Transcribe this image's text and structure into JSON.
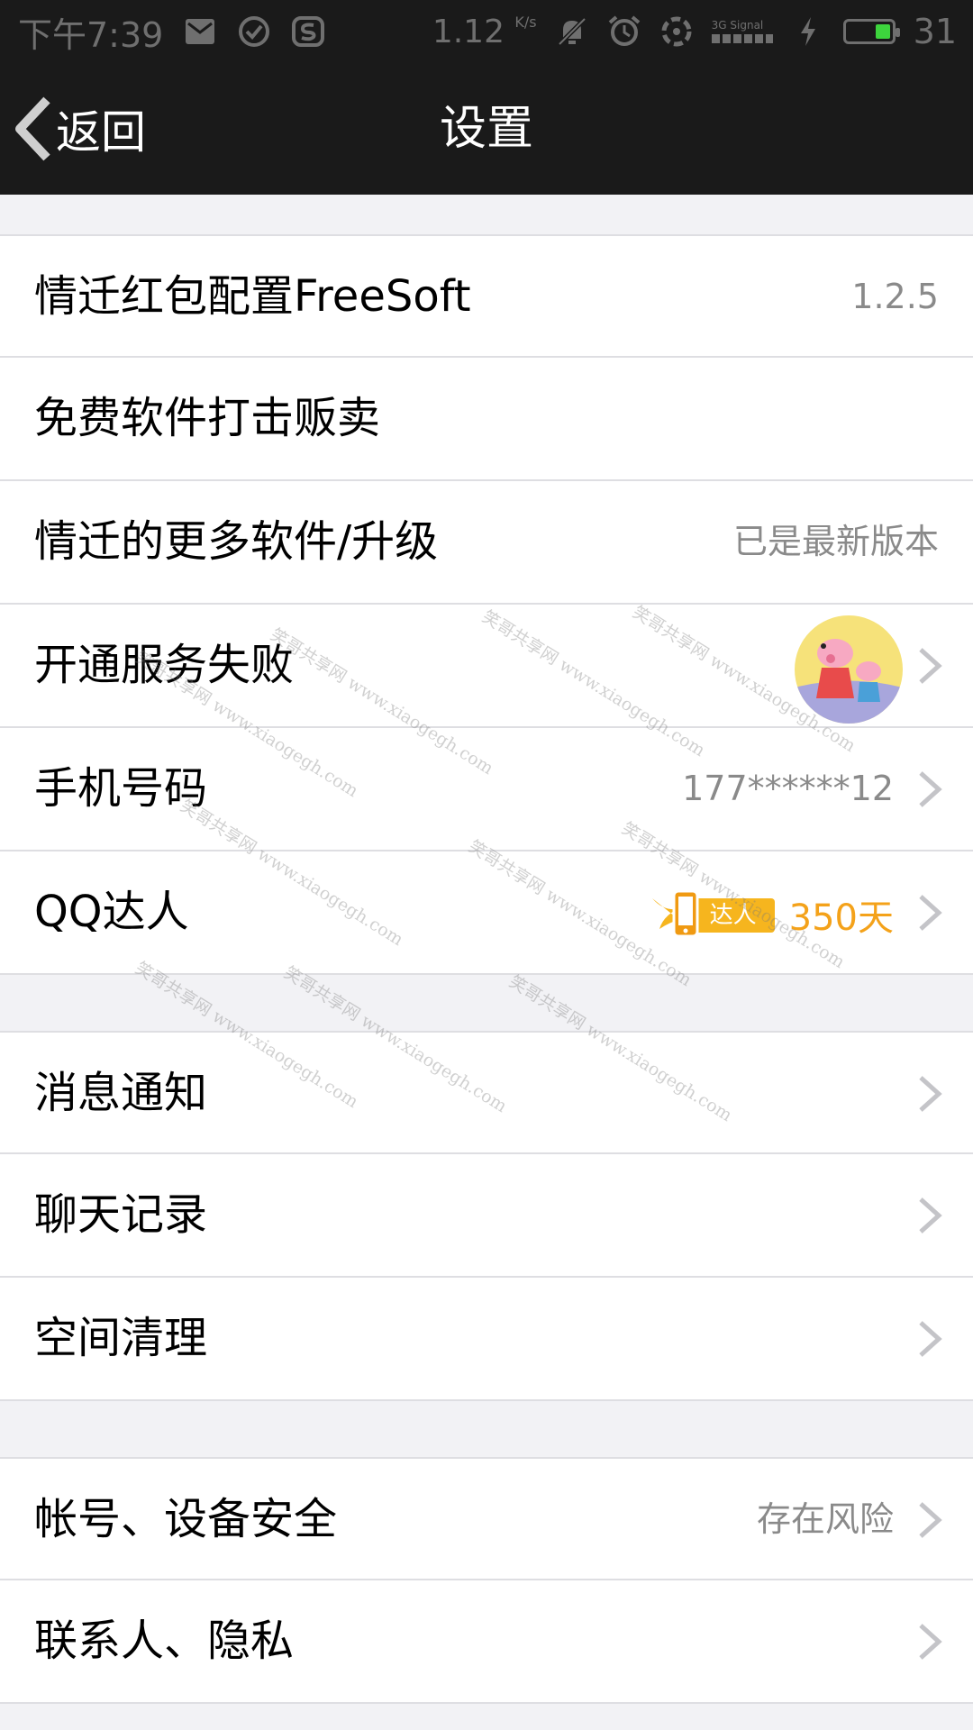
{
  "status_bar": {
    "time": "下午7:39",
    "net_speed": "1.12",
    "net_speed_unit": "K/s",
    "network_type": "3G",
    "signal_label": "Signal",
    "battery_level": "31",
    "icons": [
      "mail-icon",
      "check-circle-icon",
      "sogou-icon",
      "mute-icon",
      "alarm-icon",
      "vpn-icon",
      "signal-icon",
      "charging-icon",
      "battery-icon"
    ]
  },
  "header": {
    "back_label": "返回",
    "title": "设置"
  },
  "groups": [
    {
      "items": [
        {
          "label": "情迁红包配置FreeSoft",
          "value": "1.2.5",
          "chevron": false
        },
        {
          "label": "免费软件打击贩卖",
          "value": "",
          "chevron": false
        },
        {
          "label": "情迁的更多软件/升级",
          "value": "已是最新版本",
          "chevron": false
        },
        {
          "label": "开通服务失败",
          "value": "",
          "chevron": true,
          "accessory": "avatar"
        },
        {
          "label": "手机号码",
          "value": "177******12",
          "chevron": true
        },
        {
          "label": "QQ达人",
          "value": "",
          "chevron": true,
          "accessory": "qq-badge",
          "badge_text": "达人",
          "days": "350天"
        }
      ]
    },
    {
      "items": [
        {
          "label": "消息通知",
          "value": "",
          "chevron": true
        },
        {
          "label": "聊天记录",
          "value": "",
          "chevron": true
        },
        {
          "label": "空间清理",
          "value": "",
          "chevron": true
        }
      ]
    },
    {
      "items": [
        {
          "label": "帐号、设备安全",
          "value": "存在风险",
          "chevron": true
        },
        {
          "label": "联系人、隐私",
          "value": "",
          "chevron": true
        }
      ]
    }
  ],
  "watermark_text": "笑哥共享网 www.xiaogegh.com",
  "colors": {
    "header_bg": "#1a1a1a",
    "page_bg": "#f2f2f5",
    "accent_orange": "#f4a21a",
    "battery_green": "#3dd43d"
  }
}
